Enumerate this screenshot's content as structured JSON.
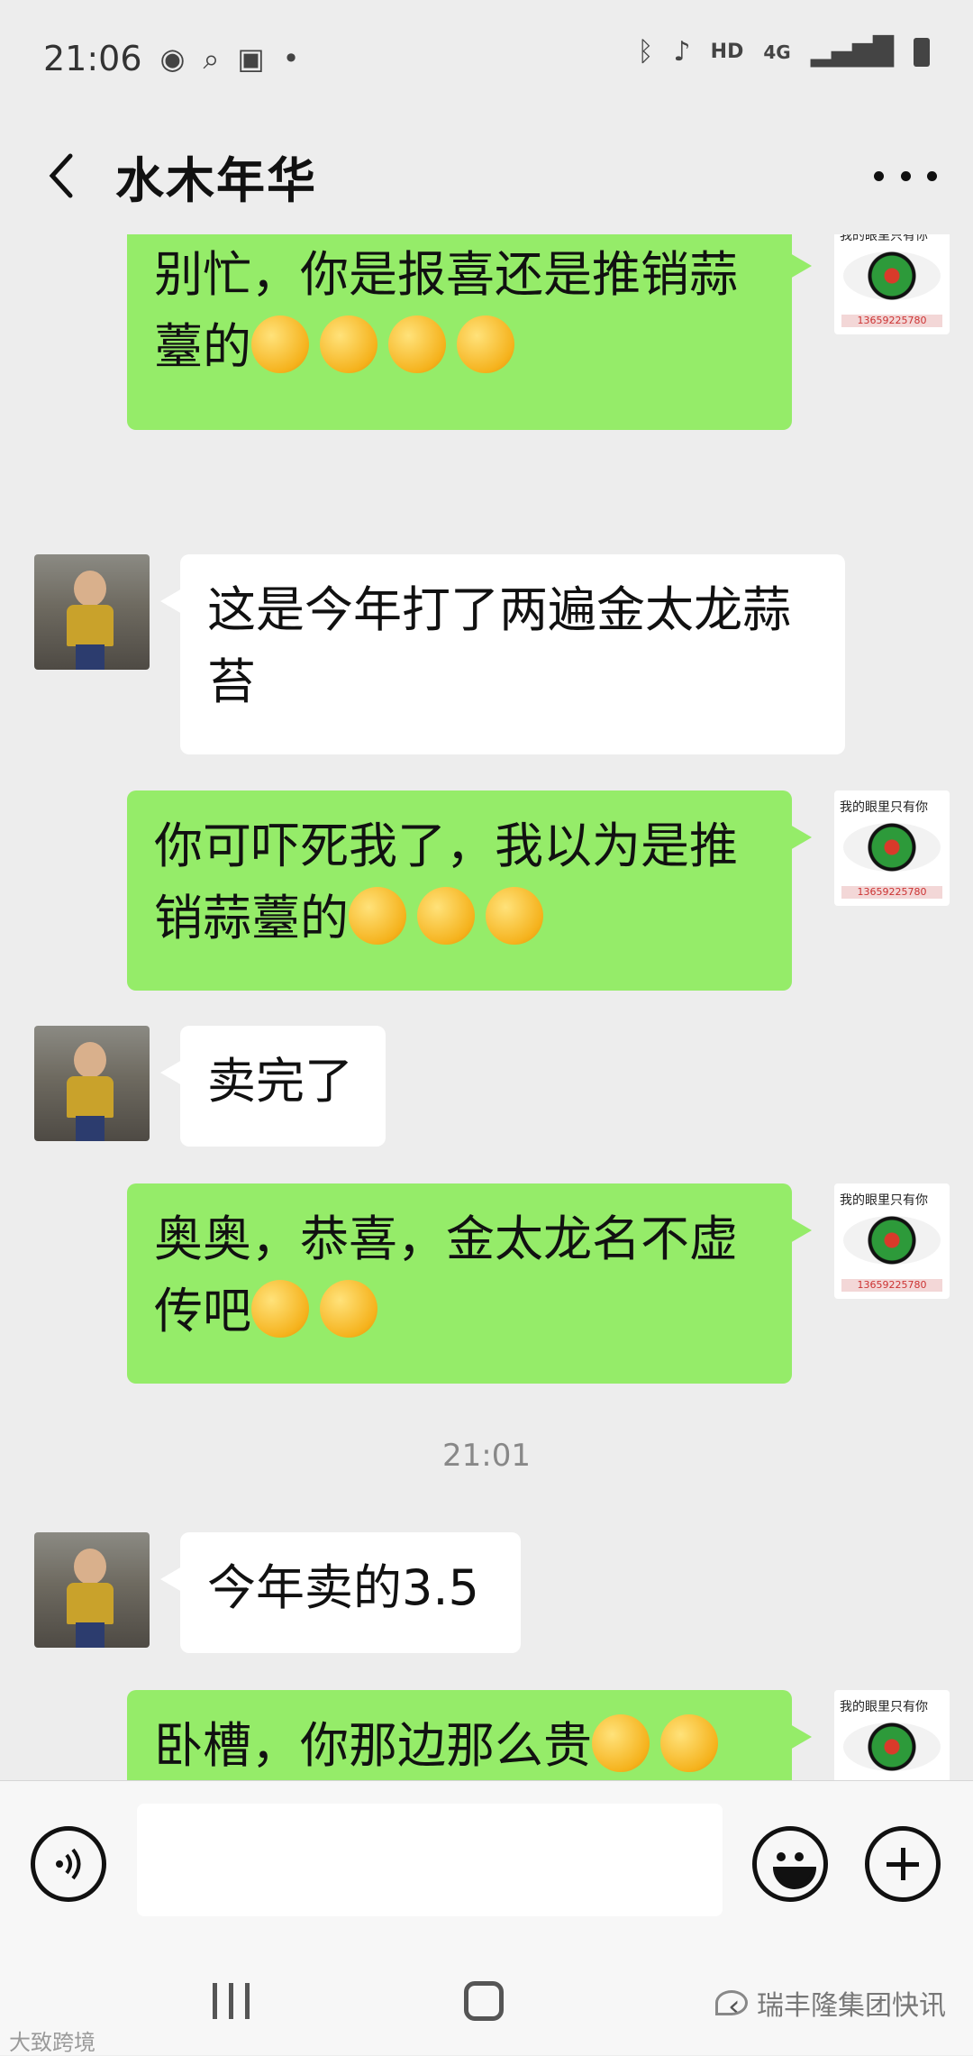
{
  "status_bar": {
    "time": "21:06",
    "network": "HD",
    "signal_type": "4G",
    "icons": [
      "globe-icon",
      "search-icon",
      "image-icon",
      "dot-icon",
      "bluetooth-icon",
      "mute-icon",
      "signal-icon",
      "battery-icon"
    ]
  },
  "header": {
    "back_icon": "chevron-left-icon",
    "title": "水木年华",
    "more_icon": "more-dots-icon"
  },
  "messages": [
    {
      "side": "out",
      "text": "别忙，你是报喜还是推销蒜薹的",
      "emojis": 4,
      "avatar_caption": "我的眼里只有你",
      "avatar_phone": "13659225780"
    },
    {
      "side": "in",
      "text": "这是今年打了两遍金太龙蒜苔"
    },
    {
      "side": "out",
      "text": "你可吓死我了，我以为是推销蒜薹的",
      "emojis": 3,
      "avatar_caption": "我的眼里只有你",
      "avatar_phone": "13659225780"
    },
    {
      "side": "in",
      "text": "卖完了"
    },
    {
      "side": "out",
      "text": "奥奥，恭喜，金太龙名不虚传吧",
      "emojis": 2,
      "avatar_caption": "我的眼里只有你",
      "avatar_phone": "13659225780"
    },
    {
      "side": "time",
      "text": "21:01"
    },
    {
      "side": "in",
      "text": "今年卖的3.5"
    },
    {
      "side": "out",
      "text": "卧槽，你那边那么贵",
      "emojis": 2,
      "avatar_caption": "我的眼里只有你",
      "avatar_phone": ""
    }
  ],
  "input_bar": {
    "voice_icon": "voice-icon",
    "input_value": "",
    "emoji_icon": "emoji-icon",
    "plus_icon": "plus-icon"
  },
  "watermarks": {
    "left": "大致跨境",
    "right": "瑞丰隆集团快讯"
  },
  "colors": {
    "background": "#ededed",
    "out_bubble": "#95ec69",
    "in_bubble": "#ffffff"
  }
}
